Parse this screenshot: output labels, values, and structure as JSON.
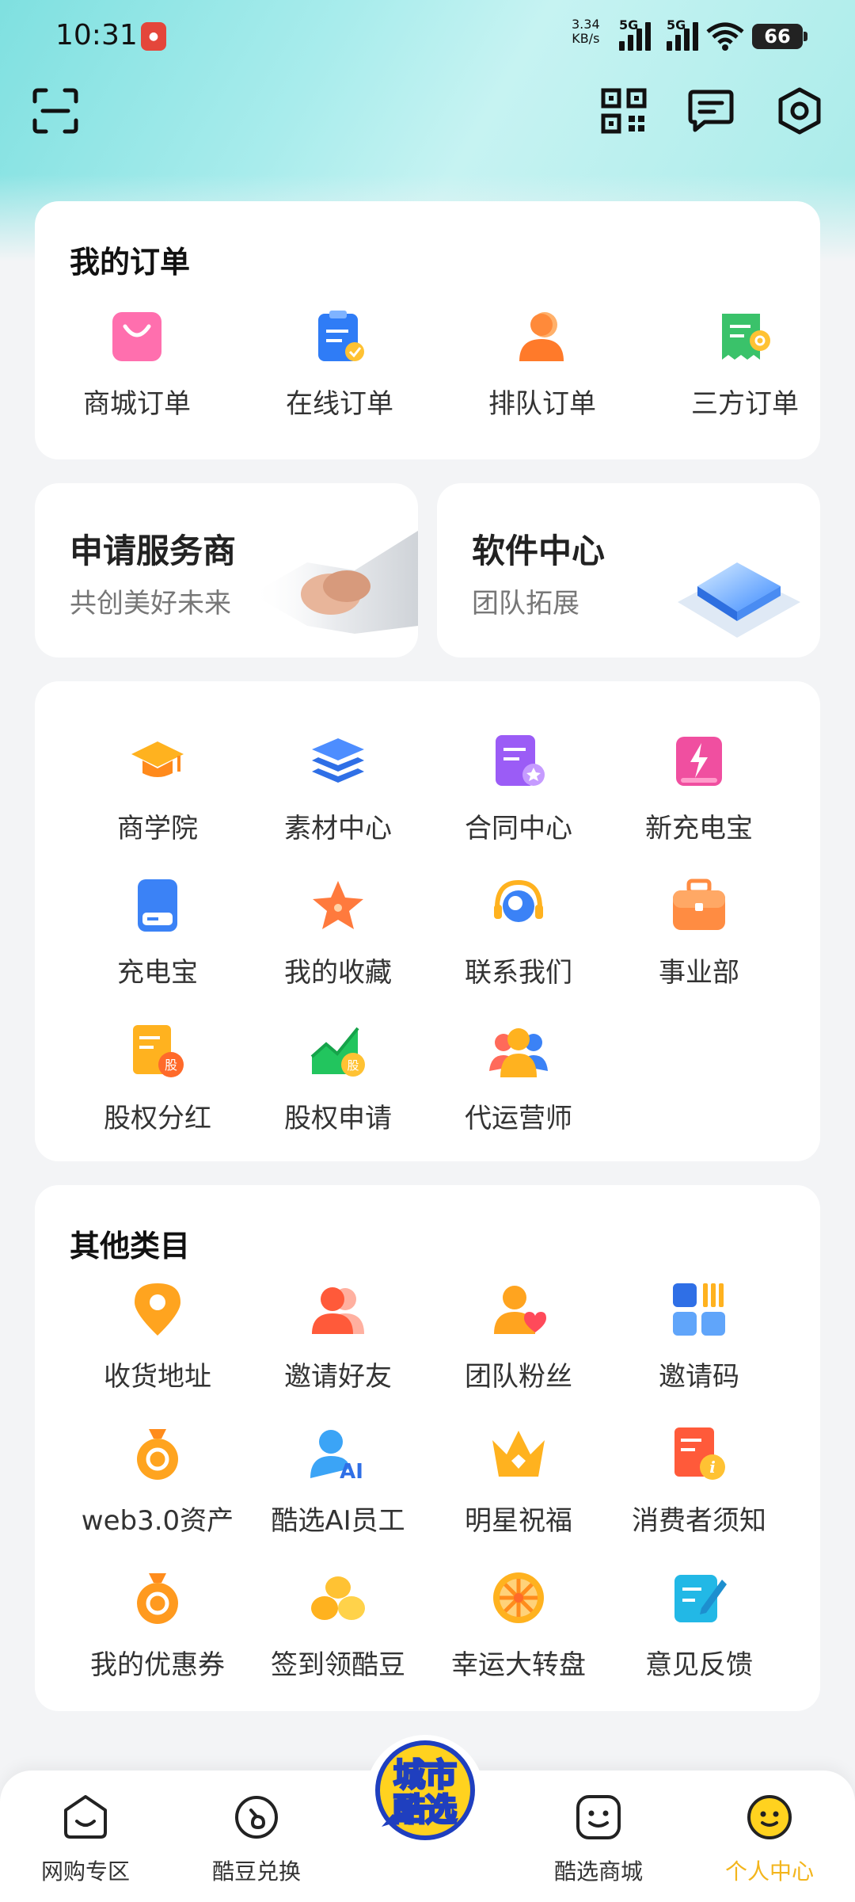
{
  "status": {
    "time": "10:31",
    "speed_top": "3.34",
    "speed_unit": "KB/s",
    "net1": "5G",
    "net2": "5G",
    "battery": "66"
  },
  "header": {
    "scan": "scan-icon",
    "qr": "qr-code-icon",
    "msg": "message-icon",
    "settings": "settings-icon"
  },
  "orders": {
    "title": "我的订单",
    "items": [
      {
        "label": "商城订单"
      },
      {
        "label": "在线订单"
      },
      {
        "label": "排队订单"
      },
      {
        "label": "三方订单"
      }
    ]
  },
  "promos": [
    {
      "title": "申请服务商",
      "subtitle": "共创美好未来"
    },
    {
      "title": "软件中心",
      "subtitle": "团队拓展"
    }
  ],
  "tools": {
    "items": [
      {
        "label": "商学院"
      },
      {
        "label": "素材中心"
      },
      {
        "label": "合同中心"
      },
      {
        "label": "新充电宝"
      },
      {
        "label": "充电宝"
      },
      {
        "label": "我的收藏"
      },
      {
        "label": "联系我们"
      },
      {
        "label": "事业部"
      },
      {
        "label": "股权分红"
      },
      {
        "label": "股权申请"
      },
      {
        "label": "代运营师"
      }
    ]
  },
  "others": {
    "title": "其他类目",
    "items": [
      {
        "label": "收货地址"
      },
      {
        "label": "邀请好友"
      },
      {
        "label": "团队粉丝"
      },
      {
        "label": "邀请码"
      },
      {
        "label": "web3.0资产"
      },
      {
        "label": "酷选AI员工"
      },
      {
        "label": "明星祝福"
      },
      {
        "label": "消费者须知"
      },
      {
        "label": "我的优惠券"
      },
      {
        "label": "签到领酷豆"
      },
      {
        "label": "幸运大转盘"
      },
      {
        "label": "意见反馈"
      }
    ]
  },
  "tabbar": {
    "items": [
      {
        "label": "网购专区"
      },
      {
        "label": "酷豆兑换"
      },
      {
        "label": "酷选商城"
      },
      {
        "label": "个人中心"
      }
    ],
    "logo_line1": "城市",
    "logo_line2": "酷选",
    "active_color": "#f3b51c"
  }
}
